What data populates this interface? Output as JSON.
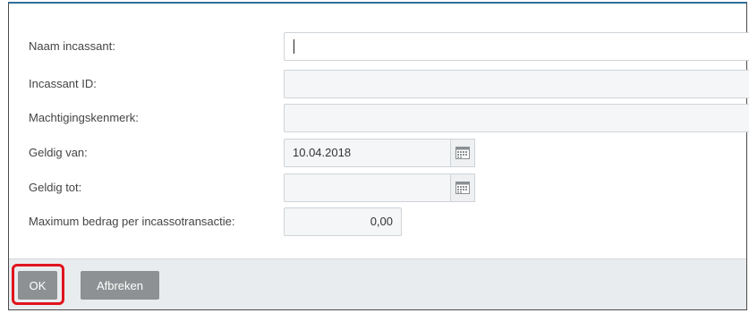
{
  "form": {
    "fields": [
      {
        "label": "Naam incassant:",
        "value": ""
      },
      {
        "label": "Incassant ID:",
        "value": ""
      },
      {
        "label": "Machtigingskenmerk:",
        "value": ""
      },
      {
        "label": "Geldig van:",
        "value": "10.04.2018"
      },
      {
        "label": "Geldig tot:",
        "value": ""
      },
      {
        "label": "Maximum bedrag per incassotransactie:",
        "value": "0,00"
      }
    ]
  },
  "footer": {
    "ok_label": "OK",
    "cancel_label": "Afbreken"
  },
  "icons": {
    "calendar": "calendar-icon"
  },
  "colors": {
    "highlight": "#e0141e",
    "button": "#8e9193",
    "footer_bg": "#e9ecee"
  }
}
